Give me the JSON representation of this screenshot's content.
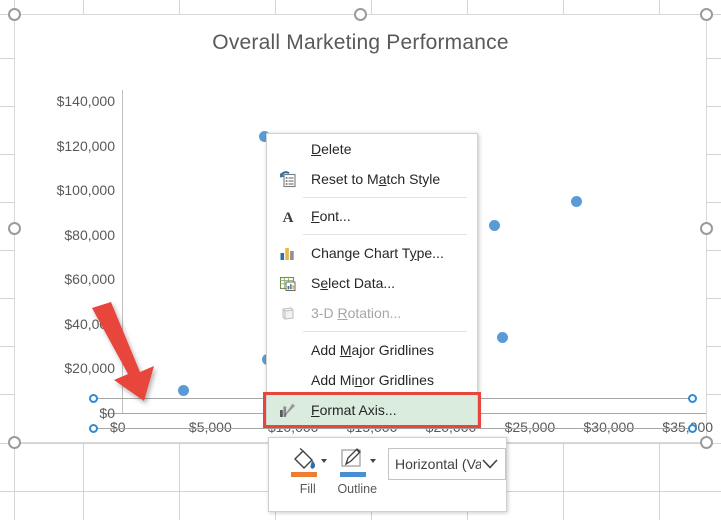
{
  "chart": {
    "title": "Overall Marketing Performance",
    "selected": true
  },
  "chart_data": {
    "type": "scatter",
    "title": "Overall Marketing Performance",
    "xlabel": "",
    "ylabel": "",
    "xlim": [
      0,
      37000
    ],
    "ylim": [
      0,
      145000
    ],
    "grid": false,
    "legend": "none",
    "series_color": "#5B9BD5",
    "x_ticks": [
      "$0",
      "$5,000",
      "$10,000",
      "$15,000",
      "$20,000",
      "$25,000",
      "$30,000",
      "$35,000"
    ],
    "x_tick_values": [
      0,
      5000,
      10000,
      15000,
      20000,
      25000,
      30000,
      35000
    ],
    "y_ticks": [
      "$0",
      "$20,000",
      "$40,000",
      "$60,000",
      "$80,000",
      "$100,000",
      "$120,000",
      "$140,000"
    ],
    "y_tick_values": [
      0,
      20000,
      40000,
      60000,
      80000,
      100000,
      120000,
      140000
    ],
    "points": [
      {
        "x": 9000,
        "y": 124000
      },
      {
        "x": 3900,
        "y": 10000
      },
      {
        "x": 9200,
        "y": 24000
      },
      {
        "x": 23600,
        "y": 84000
      },
      {
        "x": 28800,
        "y": 95000
      },
      {
        "x": 24100,
        "y": 34000
      }
    ]
  },
  "context_menu": {
    "items": [
      {
        "id": "delete",
        "label": "Delete",
        "accel": "D",
        "icon": "none",
        "disabled": false,
        "highlight": false,
        "sep_after": false
      },
      {
        "id": "reset-to-match-style",
        "label": "Reset to Match Style",
        "accel": "a",
        "icon": "reset-style-icon",
        "disabled": false,
        "highlight": false,
        "sep_after": true
      },
      {
        "id": "font",
        "label": "Font...",
        "accel": "F",
        "icon": "font-icon",
        "disabled": false,
        "highlight": false,
        "sep_after": true
      },
      {
        "id": "change-chart-type",
        "label": "Change Chart Type...",
        "accel": "y",
        "icon": "chart-type-icon",
        "disabled": false,
        "highlight": false,
        "sep_after": false
      },
      {
        "id": "select-data",
        "label": "Select Data...",
        "accel": "e",
        "icon": "select-data-icon",
        "disabled": false,
        "highlight": false,
        "sep_after": false
      },
      {
        "id": "3d-rotation",
        "label": "3-D Rotation...",
        "accel": "R",
        "icon": "rotation-icon",
        "disabled": true,
        "highlight": false,
        "sep_after": true
      },
      {
        "id": "add-major-gridlines",
        "label": "Add Major Gridlines",
        "accel": "M",
        "icon": "none",
        "disabled": false,
        "highlight": false,
        "sep_after": false
      },
      {
        "id": "add-minor-gridlines",
        "label": "Add Minor Gridlines",
        "accel": "n",
        "icon": "none",
        "disabled": false,
        "highlight": false,
        "sep_after": false
      },
      {
        "id": "format-axis",
        "label": "Format Axis...",
        "accel": "F",
        "icon": "format-axis-icon",
        "disabled": false,
        "highlight": true,
        "sep_after": false
      }
    ],
    "highlight_color": "#D9ECDD",
    "callout_color": "#E8453C"
  },
  "mini_toolbar": {
    "fill_label": "Fill",
    "fill_color": "#ED7D31",
    "outline_label": "Outline",
    "outline_color": "#4A8FD4",
    "element_select_value": "Horizontal (Val"
  },
  "annotation": {
    "arrow_color": "#E8453C"
  }
}
